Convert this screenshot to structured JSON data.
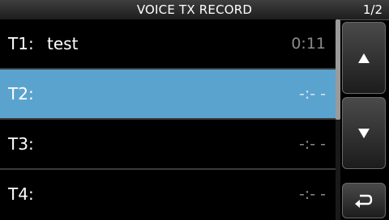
{
  "header": {
    "title": "VOICE TX RECORD",
    "page": "1/2"
  },
  "records": [
    {
      "label": "T1:",
      "name": "test",
      "time": "0:11",
      "selected": false
    },
    {
      "label": "T2:",
      "name": "",
      "time": "-:- -",
      "selected": true
    },
    {
      "label": "T3:",
      "name": "",
      "time": "-:- -",
      "selected": false
    },
    {
      "label": "T4:",
      "name": "",
      "time": "-:- -",
      "selected": false
    }
  ],
  "buttons": {
    "up_icon": "triangle-up-icon",
    "down_icon": "triangle-down-icon",
    "back_icon": "return-arrow-icon"
  },
  "colors": {
    "selected_row": "#5ba3cf",
    "background": "#000000",
    "time_dim": "#8a8a8a"
  }
}
